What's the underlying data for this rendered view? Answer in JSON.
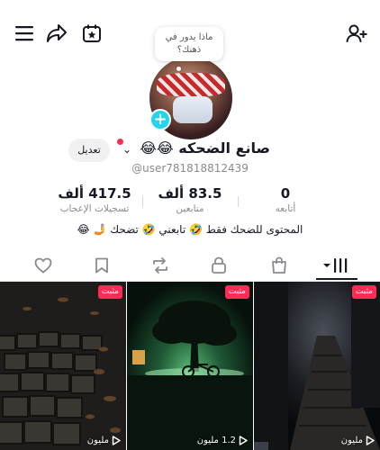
{
  "topbar": {
    "menu_icon": "hamburger-icon",
    "share_icon": "share-arrow-icon",
    "calendar_icon": "calendar-star-icon",
    "add_friend_icon": "add-user-icon"
  },
  "profile": {
    "bubble_text": "ماذا يدور في ذهنك؟",
    "username": "صانع الضحكه 😂😂",
    "handle": "@user781818812439",
    "edit_label": "تعديل"
  },
  "stats": [
    {
      "value": "0",
      "label": "أتابعه"
    },
    {
      "value": "83.5 ألف",
      "label": "متابعين"
    },
    {
      "value": "417.5 ألف",
      "label": "تسجيلات الإعجاب"
    }
  ],
  "bio": "المحتوى للضحك فقط 🤣 تابعني 🤣 تضحك 🤳 😂",
  "tabs": [
    "videos-tab",
    "shop-tab",
    "private-tab",
    "repost-tab",
    "favorites-tab",
    "liked-tab"
  ],
  "videos": [
    {
      "pinned_label": "مثبت",
      "views": "مليون"
    },
    {
      "pinned_label": "مثبت",
      "views": "1.2 مليون"
    },
    {
      "pinned_label": "مثبت",
      "views": "مليون"
    }
  ],
  "colors": {
    "accent": "#fe2c55",
    "plus_badge": "#20d5ec",
    "text": "#161823",
    "muted": "#8a8b91"
  }
}
